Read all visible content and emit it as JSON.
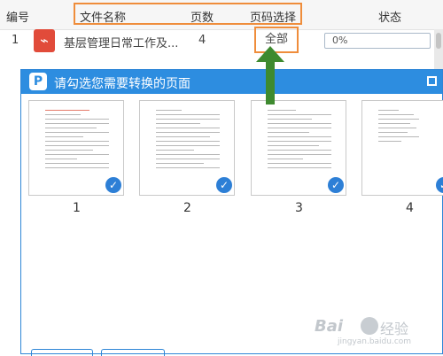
{
  "header": {
    "col_no": "编号",
    "col_filename": "文件名称",
    "col_pages": "页数",
    "col_page_select": "页码选择",
    "col_status": "状态"
  },
  "file_row": {
    "no": "1",
    "icon": "pdf-icon",
    "filename": "基层管理日常工作及...",
    "pages": "4",
    "page_select": "全部",
    "progress": "0%"
  },
  "dialog": {
    "title": "请勾选您需要转换的页面",
    "pages": [
      {
        "number": "1",
        "checked": true
      },
      {
        "number": "2",
        "checked": true
      },
      {
        "number": "3",
        "checked": true
      },
      {
        "number": "4",
        "checked": true
      }
    ]
  },
  "watermark": {
    "logo": "Bai",
    "text": "经验",
    "url": "jingyan.baidu.com"
  },
  "colors": {
    "accent": "#2d8de0",
    "highlight_border": "#ef8d3b",
    "arrow": "#3e8a2f",
    "pdf": "#e14b3a"
  }
}
